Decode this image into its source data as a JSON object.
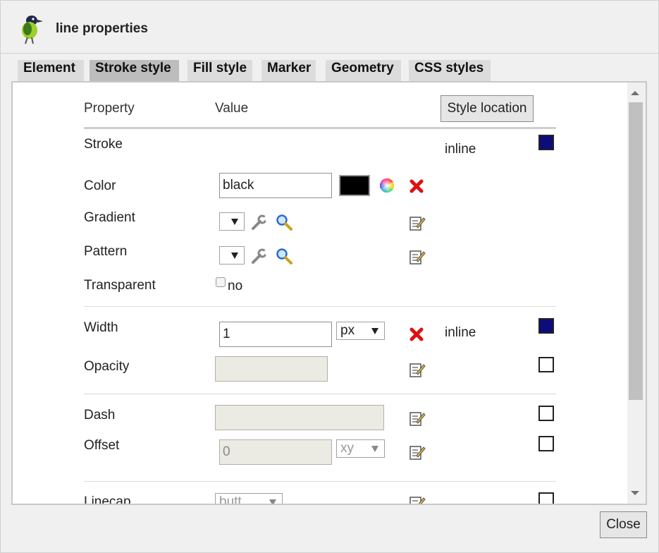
{
  "dialog": {
    "title": "line properties"
  },
  "tabs": [
    {
      "label": "Element"
    },
    {
      "label": "Stroke style"
    },
    {
      "label": "Fill style"
    },
    {
      "label": "Marker"
    },
    {
      "label": "Geometry"
    },
    {
      "label": "CSS styles"
    }
  ],
  "active_tab": "Stroke style",
  "header": {
    "property": "Property",
    "value": "Value",
    "style_location_button": "Style location"
  },
  "stroke": {
    "label": "Stroke",
    "location": "inline",
    "color": {
      "label": "Color",
      "value": "black",
      "swatch": "#000000"
    },
    "gradient": {
      "label": "Gradient"
    },
    "pattern": {
      "label": "Pattern"
    },
    "transparent": {
      "label": "Transparent",
      "checkbox_label": "no",
      "checked": false
    }
  },
  "width": {
    "label": "Width",
    "value": "1",
    "unit": "px",
    "location": "inline"
  },
  "opacity": {
    "label": "Opacity",
    "value": ""
  },
  "dash": {
    "label": "Dash",
    "value": ""
  },
  "offset": {
    "label": "Offset",
    "value": "0",
    "unit": "xy"
  },
  "linecap": {
    "label": "Linecap",
    "value": "butt"
  },
  "footer": {
    "close_button": "Close"
  },
  "colors": {
    "checked_box": "#0c0c7a",
    "delete_red": "#dd1111",
    "swatch": "#000000"
  }
}
